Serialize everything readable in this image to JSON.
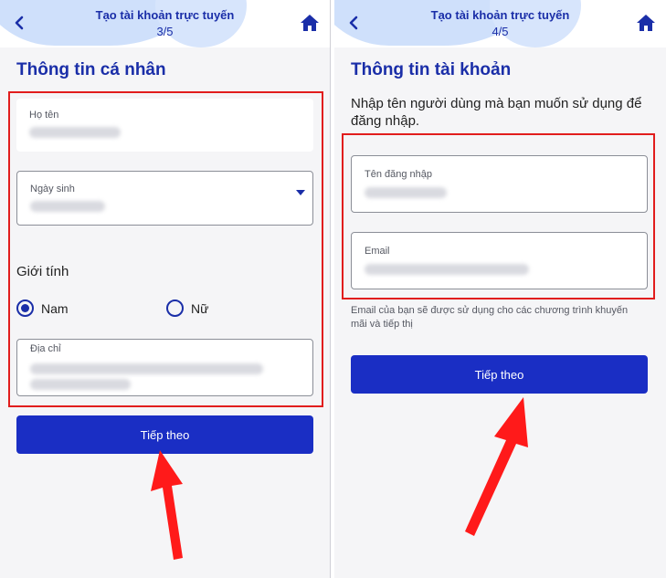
{
  "colors": {
    "brand": "#1a2ea8",
    "button": "#1a2ec4",
    "highlight": "#e11d1d",
    "arrow": "#ff1a1a"
  },
  "left": {
    "header": {
      "title": "Tạo tài khoản trực tuyến",
      "step": "3/5"
    },
    "section_title": "Thông tin cá nhân",
    "fields": {
      "name_label": "Họ tên",
      "dob_label": "Ngày sinh",
      "address_label": "Địa chỉ"
    },
    "gender": {
      "label": "Giới tính",
      "options": [
        "Nam",
        "Nữ"
      ],
      "selected": "Nam"
    },
    "next_button": "Tiếp theo"
  },
  "right": {
    "header": {
      "title": "Tạo tài khoản trực tuyến",
      "step": "4/5"
    },
    "section_title": "Thông tin tài khoản",
    "intro": "Nhập tên người dùng mà bạn muốn sử dụng để đăng nhập.",
    "fields": {
      "username_label": "Tên đăng nhập",
      "email_label": "Email"
    },
    "helper": "Email của bạn sẽ được sử dụng cho các chương trình khuyến mãi và tiếp thị",
    "next_button": "Tiếp theo"
  },
  "icons": {
    "back": "chevron-left-icon",
    "home": "home-icon",
    "dropdown": "caret-down-icon"
  }
}
